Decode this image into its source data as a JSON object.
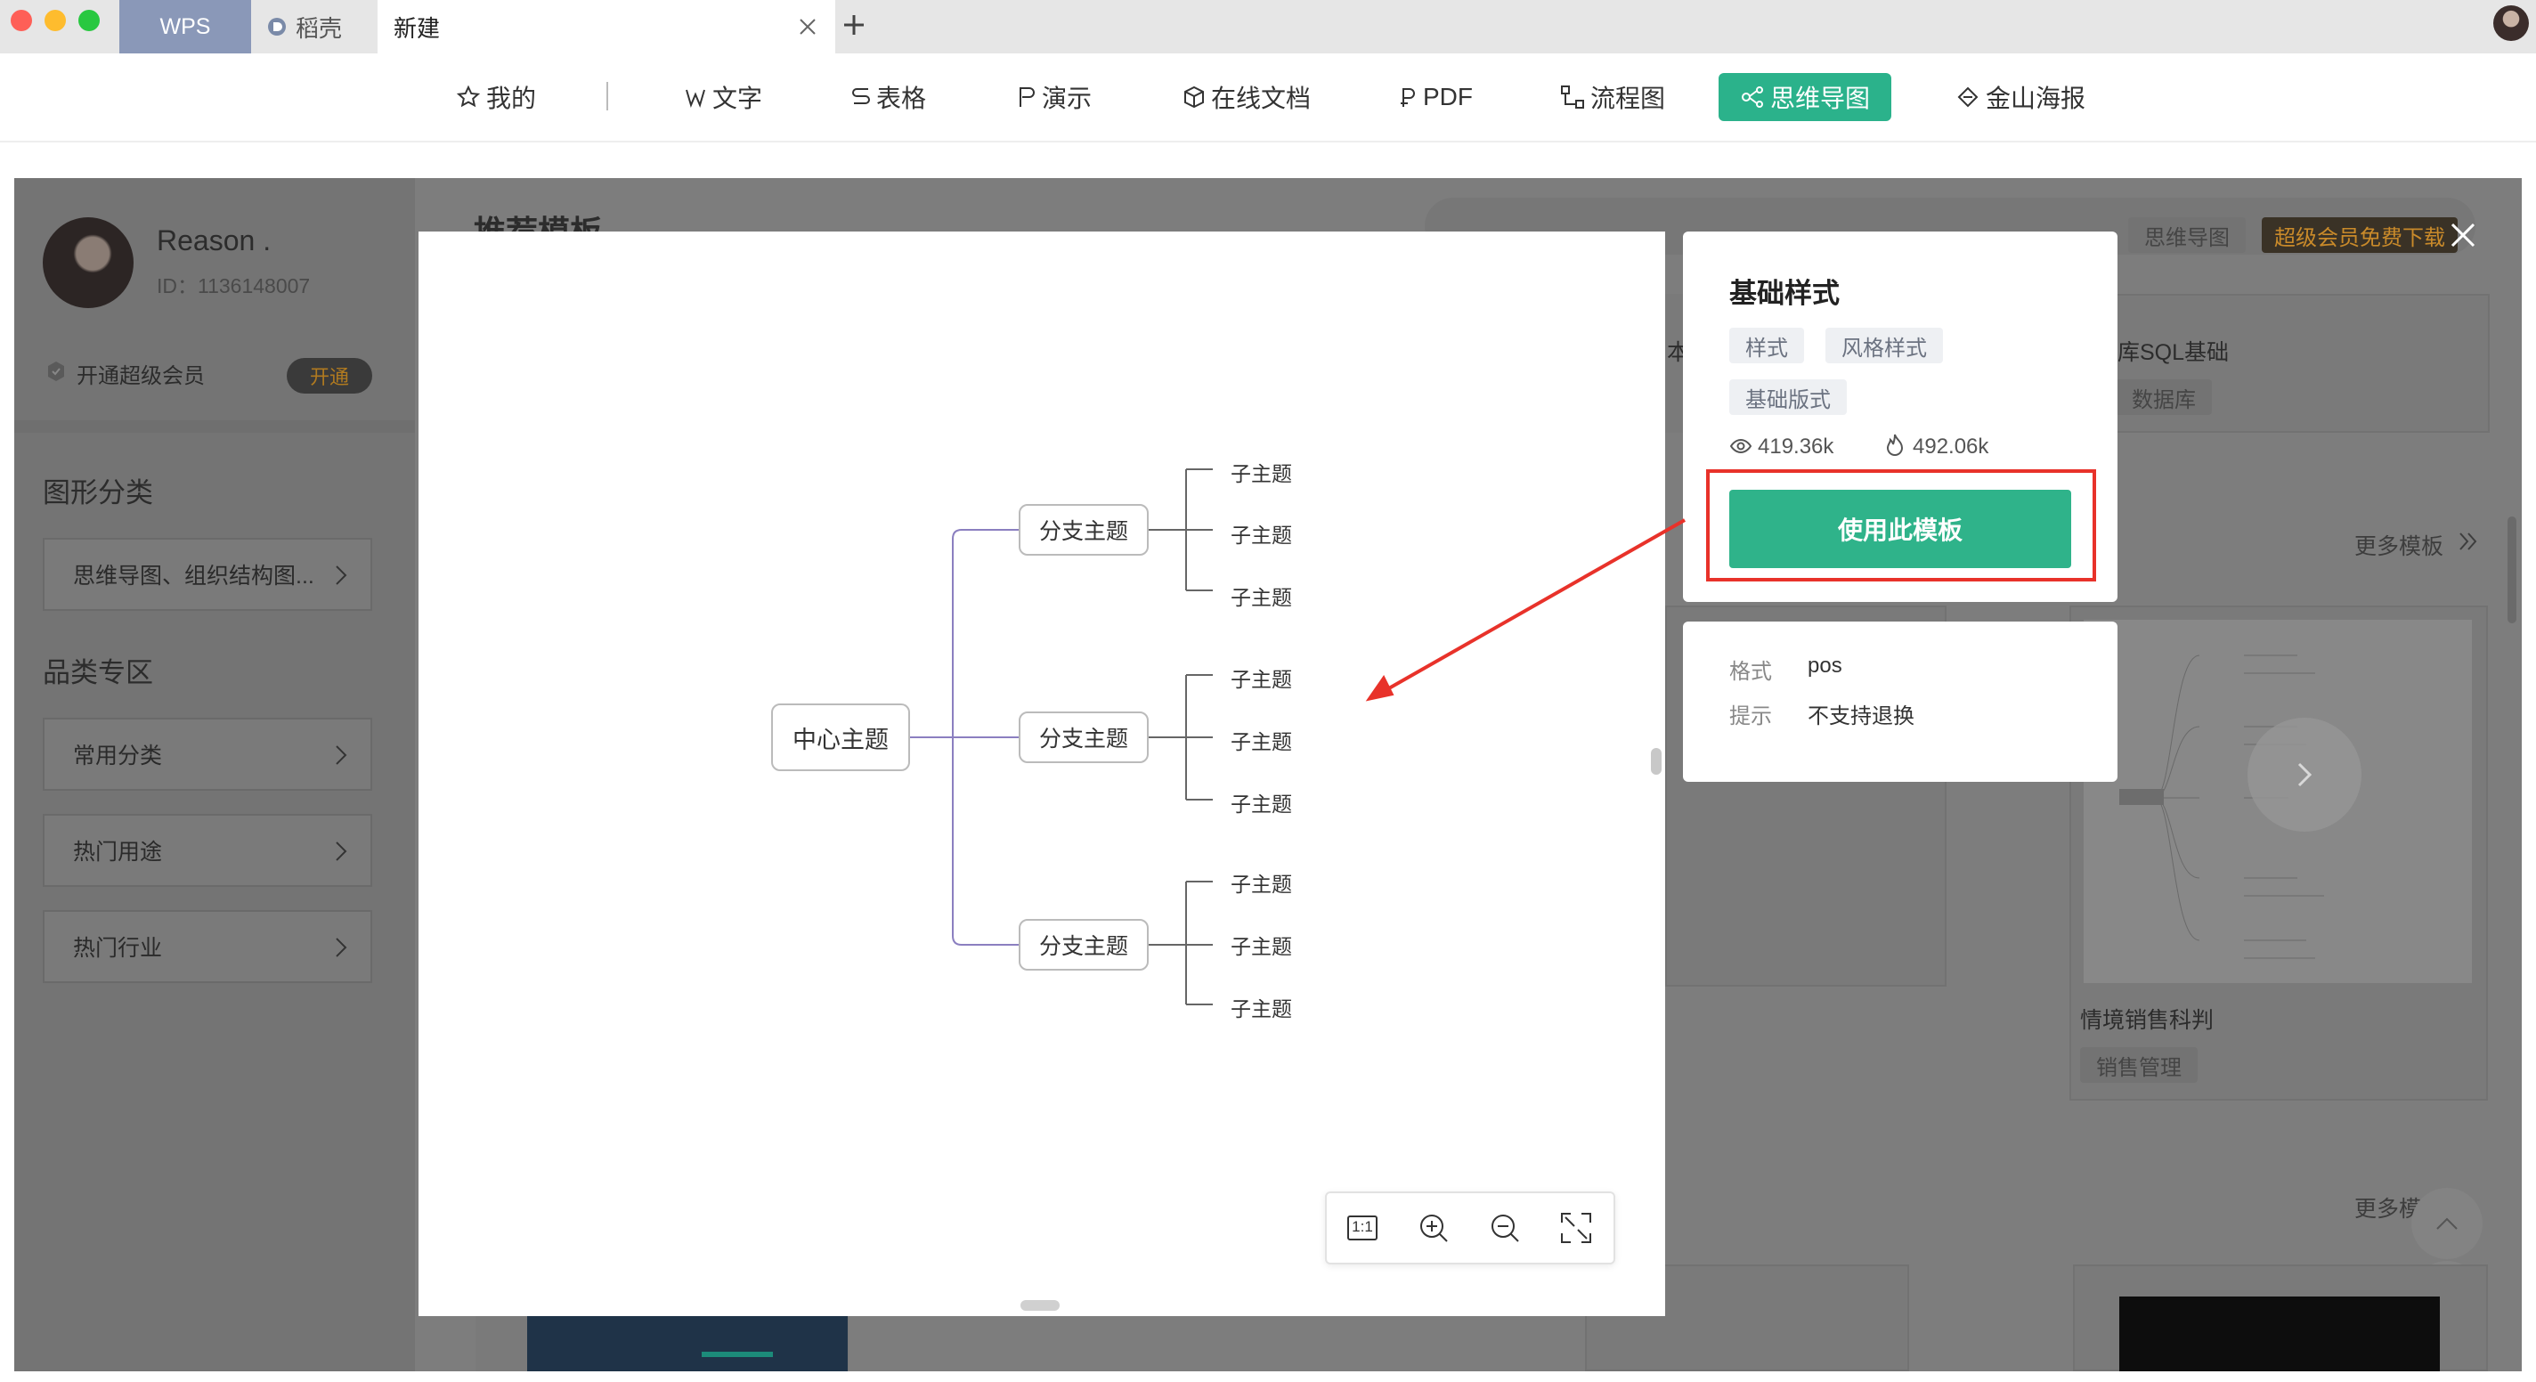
{
  "tabs": [
    {
      "label": "WPS"
    },
    {
      "label": "稻壳"
    },
    {
      "label": "新建"
    }
  ],
  "nav": {
    "items": [
      {
        "label": "我的",
        "icon": "star-icon"
      },
      {
        "label": "文字",
        "icon": "w-icon"
      },
      {
        "label": "表格",
        "icon": "s-icon"
      },
      {
        "label": "演示",
        "icon": "p-icon"
      },
      {
        "label": "在线文档",
        "icon": "cube-icon"
      },
      {
        "label": "PDF",
        "icon": "pdf-icon"
      },
      {
        "label": "流程图",
        "icon": "flow-icon"
      },
      {
        "label": "思维导图",
        "icon": "mindmap-icon"
      },
      {
        "label": "金山海报",
        "icon": "poster-icon"
      }
    ],
    "active": "思维导图",
    "accent": "#2bb28b"
  },
  "sidebar": {
    "username": "Reason .",
    "user_id": "ID：1136148007",
    "vip_text": "开通超级会员",
    "vip_button": "开通",
    "section_graphic": "图形分类",
    "graphic_button": "思维导图、组织结构图...",
    "section_category": "品类专区",
    "category_items": [
      "常用分类",
      "热门用途",
      "热门行业"
    ]
  },
  "background": {
    "heading": "推荐模板",
    "search_tags": [
      "思维导图",
      "超级会员免费下载"
    ],
    "card_right_title": "库SQL基础",
    "card_right_tag": "数据库",
    "card_left_char": "本",
    "more_templates": "更多模板",
    "more_templates_2": "更多模",
    "bottom_card_title": "情境销售科判",
    "bottom_card_tag": "销售管理"
  },
  "mindmap": {
    "center": "中心主题",
    "branches": [
      {
        "label": "分支主题",
        "children": [
          "子主题",
          "子主题",
          "子主题"
        ]
      },
      {
        "label": "分支主题",
        "children": [
          "子主题",
          "子主题",
          "子主题"
        ]
      },
      {
        "label": "分支主题",
        "children": [
          "子主题",
          "子主题",
          "子主题"
        ]
      }
    ]
  },
  "zoom_toolbar": {
    "actual_size": "1:1"
  },
  "template": {
    "title": "基础样式",
    "tags": [
      "样式",
      "风格样式",
      "基础版式"
    ],
    "views": "419.36k",
    "downloads": "492.06k",
    "use_button": "使用此模板",
    "format_label": "格式",
    "format_value": "pos",
    "tip_label": "提示",
    "tip_value": "不支持退换"
  },
  "colors": {
    "primary_green": "#2fb38a",
    "highlight_red": "#e8322a",
    "vip_gold": "#f0a12b",
    "branch_line": "#8b7fc0"
  }
}
